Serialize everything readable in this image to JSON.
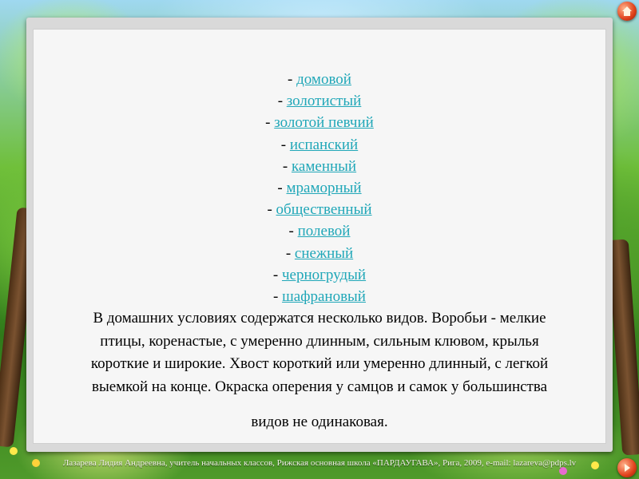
{
  "slide": {
    "list_items": [
      "домовой",
      "золотистый",
      "золотой певчий",
      "испанский",
      "каменный",
      "мраморный",
      "общественный",
      "полевой",
      "снежный",
      "черногрудый",
      "шафрановый"
    ],
    "paragraph_lines": [
      "В домашних условиях  содержатся несколько видов. Воробьи - мелкие",
      "птицы, коренастые, с умеренно длинным, сильным клювом, крылья",
      "короткие и широкие. Хвост короткий или умеренно длинный, с легкой",
      "выемкой на конце. Окраска оперения у самцов и самок у большинства"
    ],
    "paragraph_last": "видов не одинаковая.",
    "list_prefix": "- "
  },
  "footer": {
    "credit": "Лазарева Лидия Андреевна,  учитель начальных классов,  Рижская основная школа «ПАРДАУГАВА»,  Рига,  2009,  e-mail: lazareva@pdps.lv"
  },
  "colors": {
    "link": "#20a7b8",
    "text": "#000000",
    "panel": "#f6f6f6"
  },
  "icons": {
    "top_right": "home-icon",
    "bottom_right": "next-icon"
  }
}
